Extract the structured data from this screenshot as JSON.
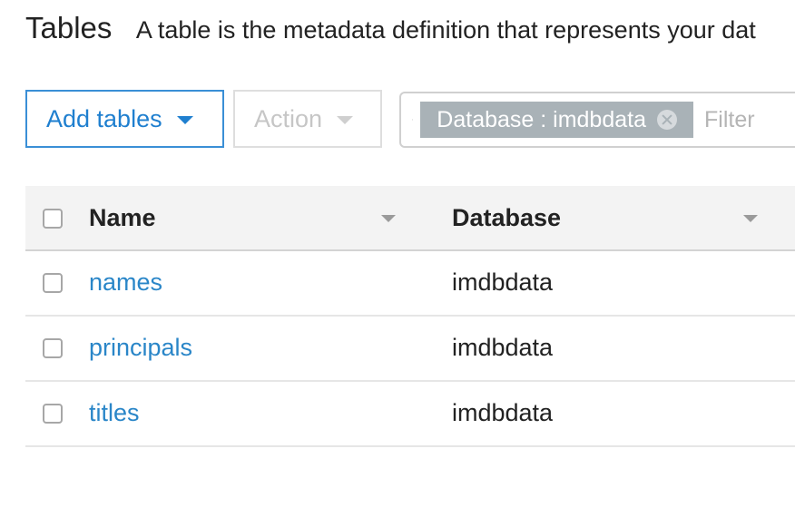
{
  "header": {
    "title": "Tables",
    "description": "A table is the metadata definition that represents your dat"
  },
  "toolbar": {
    "add_tables_label": "Add tables",
    "action_label": "Action"
  },
  "search": {
    "filter_chip": "Database : imdbdata",
    "placeholder": "Filter"
  },
  "table": {
    "columns": [
      {
        "label": "Name"
      },
      {
        "label": "Database"
      }
    ],
    "rows": [
      {
        "name": "names",
        "database": "imdbdata"
      },
      {
        "name": "principals",
        "database": "imdbdata"
      },
      {
        "name": "titles",
        "database": "imdbdata"
      }
    ]
  },
  "colors": {
    "accent": "#1f7fcf",
    "chip_bg": "#a9b2b7",
    "header_bg": "#f3f3f3"
  },
  "icons": {
    "search": "search-icon",
    "clear_chip": "close-circle-icon",
    "dropdown": "caret-down-icon",
    "sort": "sort-caret-icon"
  }
}
